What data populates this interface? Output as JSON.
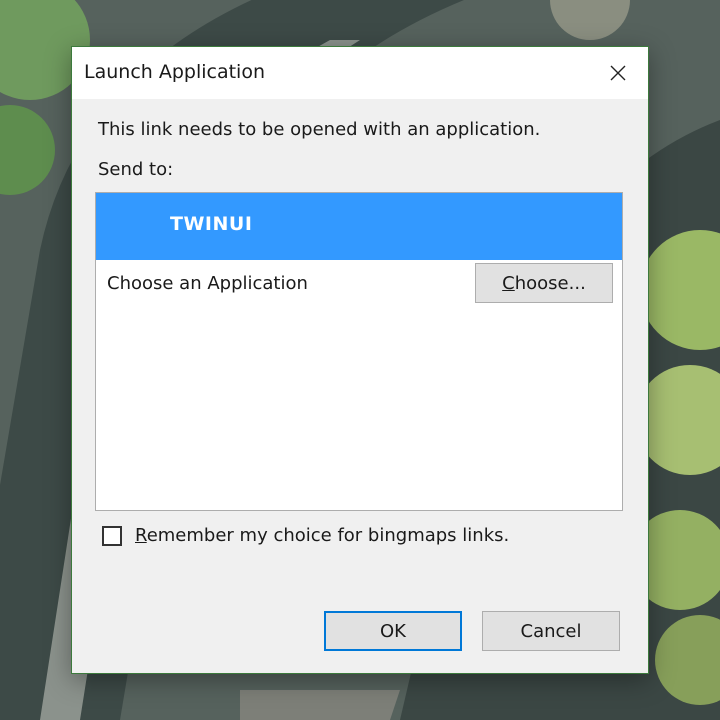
{
  "dialog": {
    "title": "Launch Application",
    "close_icon": "close-icon",
    "message": "This link needs to be opened with an application.",
    "send_to_label": "Send to:",
    "list": {
      "selected_app": "TWINUI",
      "choose_row_label": "Choose an Application",
      "choose_button": {
        "access_key": "C",
        "rest": "hoose..."
      }
    },
    "remember": {
      "checked": false,
      "access_key": "R",
      "rest": "emember my choice for bingmaps links."
    },
    "ok_label": "OK",
    "cancel_label": "Cancel"
  },
  "colors": {
    "selection": "#3399ff",
    "ok_border": "#0078d7",
    "dialog_border": "#3c7a3c"
  }
}
